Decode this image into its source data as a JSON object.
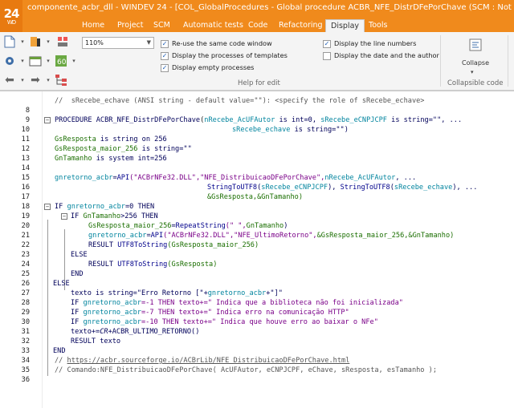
{
  "app": {
    "logo_number": "24",
    "logo_sub": "WD",
    "title": "componente_acbr_dll - WINDEV 24 - [COL_GlobalProcedures - Global procedure ACBR_NFE_DistrDFePorChave (SCM : Not che"
  },
  "tabs": [
    {
      "label": "Home"
    },
    {
      "label": "Project"
    },
    {
      "label": "SCM"
    },
    {
      "label": "Automatic tests"
    },
    {
      "label": "Code"
    },
    {
      "label": "Refactoring"
    },
    {
      "label": "Display"
    },
    {
      "label": "Tools"
    }
  ],
  "ribbon": {
    "zoom_value": "110%",
    "options": [
      {
        "label": "Re-use the same code window",
        "checked": true
      },
      {
        "label": "Display the processes of templates",
        "checked": true
      },
      {
        "label": "Display empty processes",
        "checked": true
      },
      {
        "label": "Display the line numbers",
        "checked": true
      },
      {
        "label": "Display the date and the author",
        "checked": false
      }
    ],
    "help_group_label": "Help for edit",
    "collapse_label": "Collapse",
    "collapsible_group_label": "Collapsible code"
  },
  "code_lines": [
    {
      "n": "8"
    },
    {
      "n": "9"
    },
    {
      "n": "10"
    },
    {
      "n": "11"
    },
    {
      "n": "12"
    },
    {
      "n": "13"
    },
    {
      "n": "14"
    },
    {
      "n": "15"
    },
    {
      "n": "16"
    },
    {
      "n": "17"
    },
    {
      "n": "18"
    },
    {
      "n": "19"
    },
    {
      "n": "20"
    },
    {
      "n": "21"
    },
    {
      "n": "22"
    },
    {
      "n": "23"
    },
    {
      "n": "24"
    },
    {
      "n": "25"
    },
    {
      "n": "26"
    },
    {
      "n": "27"
    },
    {
      "n": "28"
    },
    {
      "n": "29"
    },
    {
      "n": "30"
    },
    {
      "n": "31"
    },
    {
      "n": "32"
    },
    {
      "n": "33"
    },
    {
      "n": "34"
    },
    {
      "n": "35"
    },
    {
      "n": "36"
    }
  ],
  "code": {
    "l8": "//  sRecebe_echave (ANSI string - default value=\"\"): <specify the role of sRecebe_echave>",
    "l10a": "PROCEDURE ",
    "l10b": "ACBR_NFE_DistrDFePorChave",
    "l10c": "(",
    "l10d": "nRecebe_AcUFAutor",
    "l10e": " is int=0, ",
    "l10f": "sRecebe_eCNPJCPF",
    "l10g": " is string=\"\", ...",
    "l11a": "sRecebe_echave",
    "l11b": " is string=\"\")",
    "l12a": "GsResposta",
    "l12b": " is string on 256",
    "l13a": "GsResposta_maior_256",
    "l13b": " is string=\"\"",
    "l14a": "GnTamanho",
    "l14b": " is system int=256",
    "l16a": "gnretorno_acbr",
    "l16b": "=",
    "l16c": "API",
    "l16d": "(\"ACBrNFe32.DLL\",\"NFE_DistribuicaoDFePorChave\",",
    "l16e": "nRecebe_AcUFAutor",
    "l16f": ", ...",
    "l17a": "StringToUTF8",
    "l17b": "(",
    "l17c": "sRecebe_eCNPJCPF",
    "l17d": "), ",
    "l17e": "StringToUTF8",
    "l17f": "(",
    "l17g": "sRecebe_echave",
    "l17h": "), ...",
    "l18a": "&GsResposta,&GnTamanho)",
    "l19a": "IF ",
    "l19b": "gnretorno_acbr",
    "l19c": "=0 THEN",
    "l20a": "IF ",
    "l20b": "GnTamanho",
    "l20c": ">256 THEN",
    "l21a": "GsResposta_maior_256",
    "l21b": "=",
    "l21c": "RepeatString",
    "l21d": "(\" \",",
    "l21e": "GnTamanho",
    "l21f": ")",
    "l22a": "gnretorno_acbr",
    "l22b": "=",
    "l22c": "API",
    "l22d": "(\"ACBrNFe32.DLL\",\"NFE_UltimoRetorno\",",
    "l22e": "&GsResposta_maior_256,&GnTamanho)",
    "l23a": "RESULT ",
    "l23b": "UTF8ToString",
    "l23c": "(GsResposta_maior_256)",
    "l24": "ELSE",
    "l25a": "RESULT ",
    "l25b": "UTF8ToString",
    "l25c": "(GsResposta)",
    "l26": "END",
    "l27": "ELSE",
    "l28a": "texto",
    "l28b": " is string=\"Erro Retorno [\"+",
    "l28c": "gnretorno_acbr",
    "l28d": "+\"]\"",
    "l29a": "IF ",
    "l29b": "gnretorno_acbr",
    "l29c": "=-1 THEN texto+=\" Indica que a biblioteca não foi inicializada\"",
    "l30a": "IF ",
    "l30b": "gnretorno_acbr",
    "l30c": "=-7 THEN texto+=\" Indica erro na comunicação HTTP\"",
    "l31a": "IF ",
    "l31b": "gnretorno_acbr",
    "l31c": "=-10 THEN texto+=\" Indica que houve erro ao baixar o NFe\"",
    "l32a": "texto+=",
    "l32b": "CR",
    "l32c": "+ACBR_ULTIMO_RETORNO()",
    "l33": "RESULT texto",
    "l34": "END",
    "l35a": "// ",
    "l35b": "https://acbr.sourceforge.io/ACBrLib/NFE_DistribuicaoDFePorChave.html",
    "l36": "// Comando:NFE_DistribuicaoDFePorChave( AcUFAutor, eCNPJCPF, eChave, sResposta, esTamanho );"
  }
}
